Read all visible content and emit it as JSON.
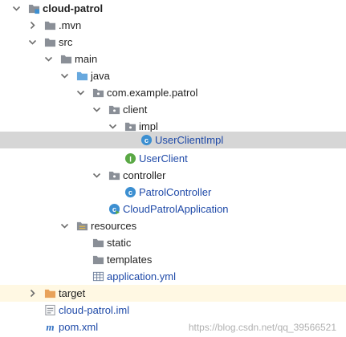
{
  "tree": {
    "project": "cloud-patrol",
    "mvn": ".mvn",
    "src": "src",
    "main": "main",
    "java": "java",
    "package": "com.example.patrol",
    "client": "client",
    "impl": "impl",
    "user_client_impl": "UserClientImpl",
    "user_client": "UserClient",
    "controller": "controller",
    "patrol_controller": "PatrolController",
    "application_class": "CloudPatrolApplication",
    "resources": "resources",
    "static": "static",
    "templates": "templates",
    "application_yml": "application.yml",
    "target": "target",
    "iml": "cloud-patrol.iml",
    "pom": "pom.xml"
  },
  "watermark": "https://blog.csdn.net/qq_39566521",
  "colors": {
    "selection": "#d6d6d6",
    "excluded_row": "#fff8e3",
    "class_icon": "#3c8fd1",
    "interface_icon": "#5aa845",
    "folder": "#8a8f97",
    "source_folder": "#67a8de",
    "excluded_folder": "#e8a25a"
  }
}
